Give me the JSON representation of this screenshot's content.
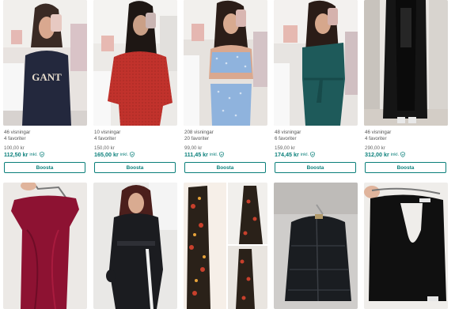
{
  "items_row1": [
    {
      "views": "46 visningar",
      "favs": "4 favoriter",
      "price": "100,00 kr",
      "price_incl": "112,50 kr",
      "incl_label": "inkl.",
      "boost_label": "Boosta",
      "image": "woman-mirror-selfie-navy-gant-tshirt"
    },
    {
      "views": "10 visningar",
      "favs": "4 favoriter",
      "price": "150,00 kr",
      "price_incl": "165,00 kr",
      "incl_label": "inkl.",
      "boost_label": "Boosta",
      "image": "woman-mirror-selfie-red-knit-sweater"
    },
    {
      "views": "208 visningar",
      "favs": "20 favoriter",
      "price": "99,00 kr",
      "price_incl": "111,45 kr",
      "incl_label": "inkl.",
      "boost_label": "Boosta",
      "image": "woman-mirror-selfie-blue-floral-set"
    },
    {
      "views": "48 visningar",
      "favs": "6 favoriter",
      "price": "159,00 kr",
      "price_incl": "174,45 kr",
      "incl_label": "inkl.",
      "boost_label": "Boosta",
      "image": "woman-mirror-selfie-green-one-shoulder-dress"
    },
    {
      "views": "46 visningar",
      "favs": "4 favoriter",
      "price": "290,00 kr",
      "price_incl": "312,00 kr",
      "incl_label": "inkl.",
      "boost_label": "Boosta",
      "image": "person-black-long-coat"
    }
  ],
  "items_row2": [
    {
      "image": "burgundy-satin-off-shoulder-dress-on-hanger"
    },
    {
      "image": "woman-black-ski-jumpsuit"
    },
    {
      "image": "floral-maxi-dress-collage"
    },
    {
      "image": "black-puffer-jacket-on-bed"
    },
    {
      "image": "black-cutout-top-on-hanger"
    }
  ],
  "colors": {
    "accent": "#0a7f7a"
  },
  "icons": {
    "buyer_protection": "shield-check-icon"
  }
}
